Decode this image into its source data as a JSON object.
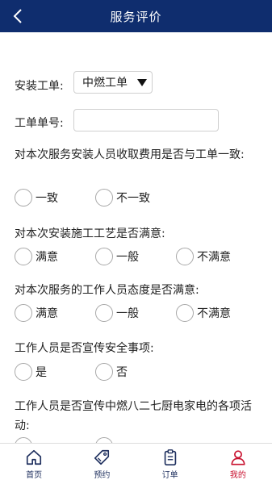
{
  "header": {
    "title": "服务评价"
  },
  "form": {
    "install_order": {
      "label": "安装工单:",
      "selected": "中燃工单"
    },
    "order_number": {
      "label": "工单单号:",
      "value": ""
    }
  },
  "questions": [
    {
      "text": "对本次服务安装人员收取费用是否与工单一致:",
      "options": [
        "一致",
        "不一致"
      ]
    },
    {
      "text": "对本次安装施工工艺是否满意:",
      "options": [
        "满意",
        "一般",
        "不满意"
      ]
    },
    {
      "text": "对本次服务的工作人员态度是否满意:",
      "options": [
        "满意",
        "一般",
        "不满意"
      ]
    },
    {
      "text": "工作人员是否宣传安全事项:",
      "options": [
        "是",
        "否"
      ]
    },
    {
      "text": "工作人员是否宣传中燃八二七厨电家电的各项活动:",
      "options": []
    }
  ],
  "tabbar": {
    "items": [
      {
        "label": "首页",
        "icon": "home-icon"
      },
      {
        "label": "预约",
        "icon": "tag-icon"
      },
      {
        "label": "订单",
        "icon": "clipboard-icon"
      },
      {
        "label": "我的",
        "icon": "person-icon"
      }
    ],
    "active_index": 3
  },
  "colors": {
    "header_bg": "#0f2d6e",
    "tab_active": "#c8102e",
    "tab_inactive": "#1e2f5e"
  }
}
